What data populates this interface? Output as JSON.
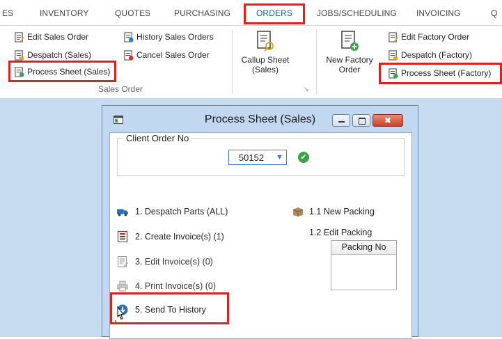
{
  "tabs": [
    "ES",
    "INVENTORY",
    "QUOTES",
    "PURCHASING",
    "ORDERS",
    "JOBS/SCHEDULING",
    "INVOICING",
    "Q"
  ],
  "active_tab": "ORDERS",
  "ribbon": {
    "sales_group_label": "Sales Order",
    "edit_sales_order": "Edit Sales Order",
    "history_sales_orders": "History Sales Orders",
    "despatch_sales": "Despatch (Sales)",
    "cancel_sales_order": "Cancel Sales Order",
    "process_sheet_sales": "Process Sheet (Sales)",
    "callup_sheet_line1": "Callup Sheet",
    "callup_sheet_line2": "(Sales)",
    "new_factory_line1": "New Factory",
    "new_factory_line2": "Order",
    "edit_factory_order": "Edit Factory Order",
    "despatch_factory": "Despatch (Factory)",
    "process_sheet_factory": "Process Sheet (Factory)"
  },
  "dialog": {
    "title": "Process Sheet (Sales)",
    "client_order_label": "Client Order No",
    "client_order_value": "50152",
    "actions": [
      "1. Despatch Parts  (ALL)",
      "2. Create Invoice(s)  (1)",
      "3. Edit Invoice(s)  (0)",
      "4. Print Invoice(s)  (0)",
      "5. Send To History"
    ],
    "new_packing": "1.1  New Packing",
    "edit_packing": "1.2  Edit Packing",
    "packing_header": "Packing No"
  },
  "colors": {
    "highlight": "#e0201c",
    "accent": "#1f5fa8",
    "workarea": "#c6dbf0",
    "ok_green": "#3aa34a"
  }
}
